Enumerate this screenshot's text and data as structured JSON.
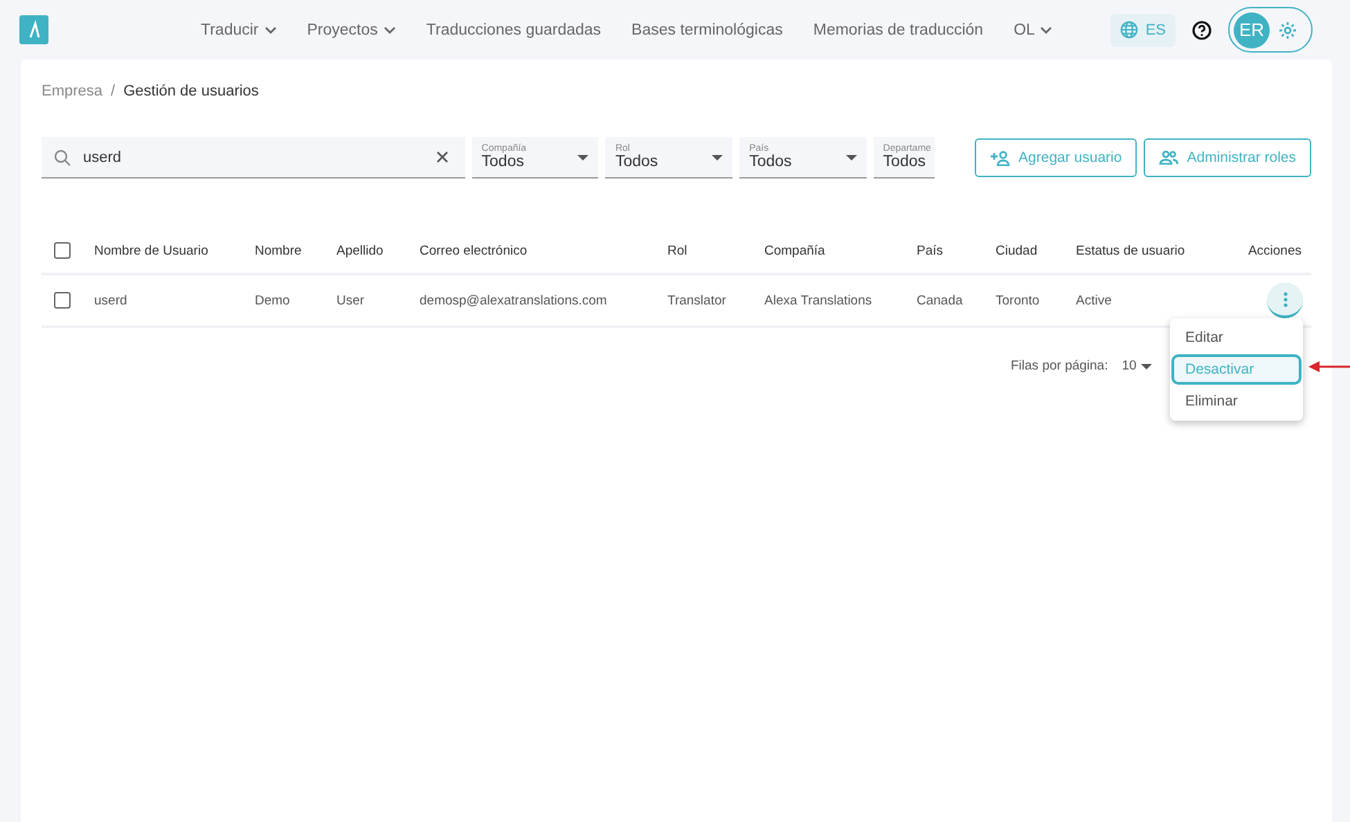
{
  "nav": [
    {
      "label": "Traducir",
      "dropdown": true
    },
    {
      "label": "Proyectos",
      "dropdown": true
    },
    {
      "label": "Traducciones guardadas",
      "dropdown": false
    },
    {
      "label": "Bases terminológicas",
      "dropdown": false
    },
    {
      "label": "Memorias de traducción",
      "dropdown": false
    },
    {
      "label": "OL",
      "dropdown": true
    }
  ],
  "language": "ES",
  "avatar": "ER",
  "breadcrumb": {
    "items": [
      "Empresa",
      "Gestión de usuarios"
    ],
    "separator": "/"
  },
  "search": {
    "value": "userd"
  },
  "filters": [
    {
      "label": "Compañía",
      "value": "Todos",
      "cut": false
    },
    {
      "label": "Rol",
      "value": "Todos",
      "cut": false
    },
    {
      "label": "País",
      "value": "Todos",
      "cut": false
    },
    {
      "label": "Departame",
      "value": "Todos",
      "cut": true
    }
  ],
  "buttons": [
    {
      "label": "Agregar usuario",
      "kind": "add"
    },
    {
      "label": "Administrar roles",
      "kind": "roles"
    }
  ],
  "table": {
    "columns": [
      "Nombre de Usuario",
      "Nombre",
      "Apellido",
      "Correo electrónico",
      "Rol",
      "Compañía",
      "País",
      "Ciudad",
      "Estatus de usuario",
      "Acciones"
    ],
    "header_checked": false,
    "rows": [
      {
        "checked": false,
        "cells": [
          "userd",
          "Demo",
          "User",
          "demosp@alexatranslations.com",
          "Translator",
          "Alexa Translations",
          "Canada",
          "Toronto",
          "Active"
        ]
      }
    ]
  },
  "pagination": {
    "label": "Filas por página:",
    "value": "10"
  },
  "menu": [
    {
      "label": "Editar",
      "selected": false
    },
    {
      "label": "Desactivar",
      "selected": true
    },
    {
      "label": "Eliminar",
      "selected": false
    }
  ]
}
